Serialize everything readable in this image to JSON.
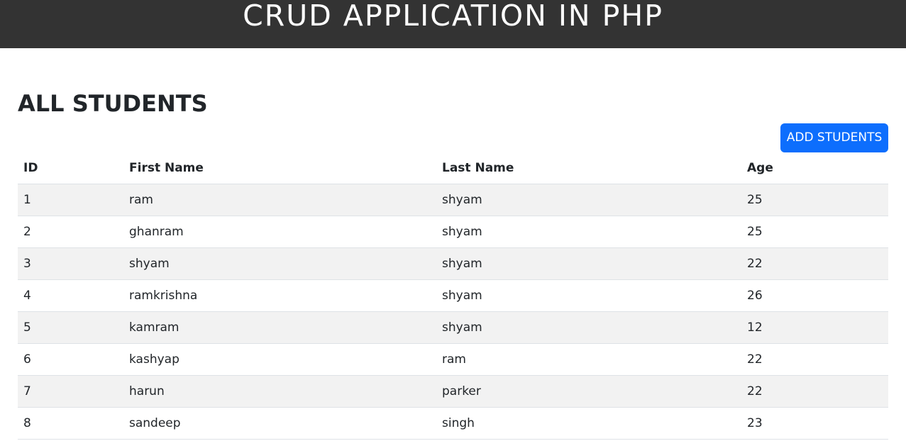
{
  "header": {
    "title": "CRUD APPLICATION IN PHP"
  },
  "main": {
    "section_title": "ALL STUDENTS",
    "add_button_label": "ADD STUDENTS",
    "table": {
      "columns": [
        "ID",
        "First Name",
        "Last Name",
        "Age"
      ],
      "rows": [
        [
          "1",
          "ram",
          "shyam",
          "25"
        ],
        [
          "2",
          "ghanram",
          "shyam",
          "25"
        ],
        [
          "3",
          "shyam",
          "shyam",
          "22"
        ],
        [
          "4",
          "ramkrishna",
          "shyam",
          "26"
        ],
        [
          "5",
          "kamram",
          "shyam",
          "12"
        ],
        [
          "6",
          "kashyap",
          "ram",
          "22"
        ],
        [
          "7",
          "harun",
          "parker",
          "22"
        ],
        [
          "8",
          "sandeep",
          "singh",
          "23"
        ]
      ]
    }
  },
  "colors": {
    "header_bg": "#333333",
    "primary_button": "#0d6efd",
    "striped_row": "#f2f2f2"
  }
}
